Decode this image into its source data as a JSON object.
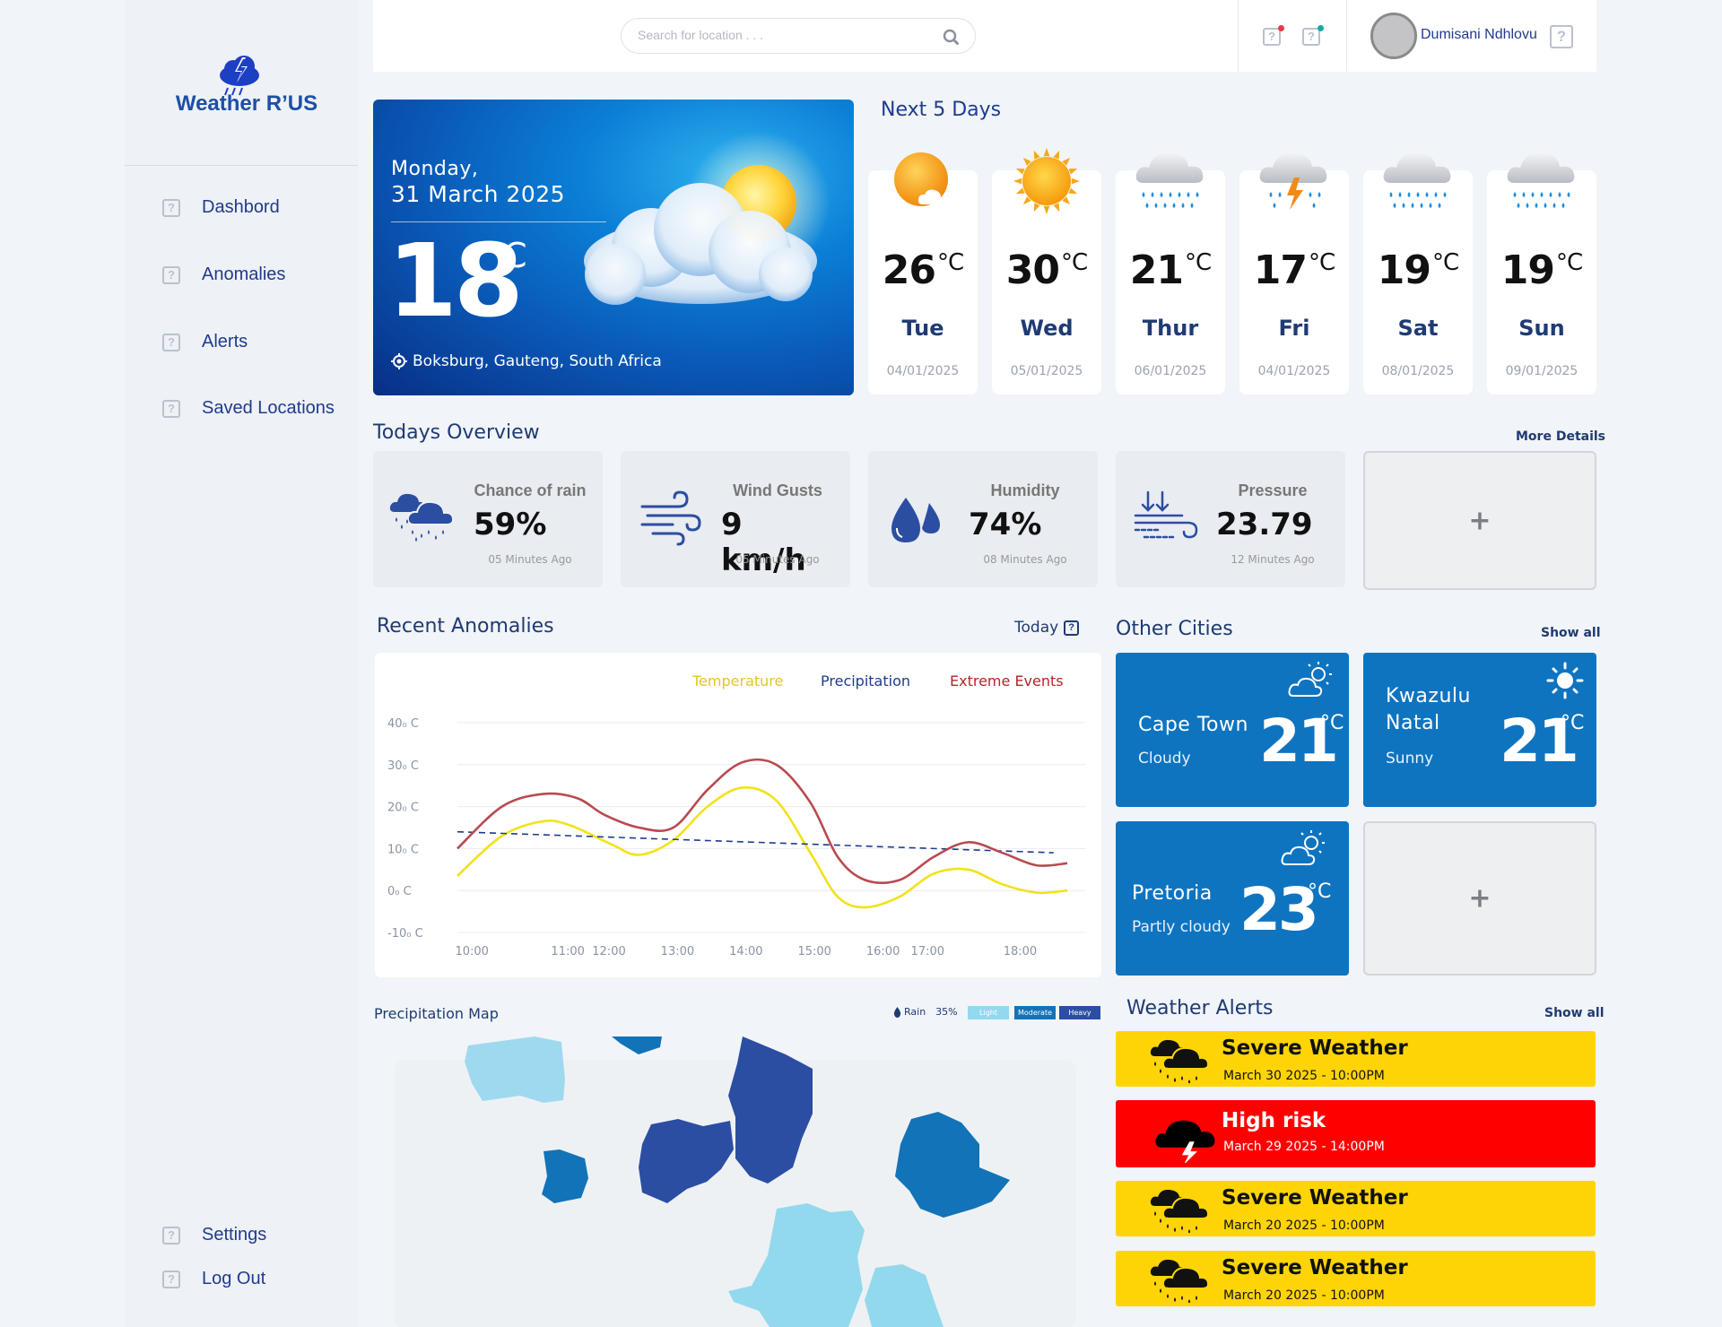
{
  "brand": {
    "name": "Weather R’US"
  },
  "nav": {
    "items": [
      "Dashbord",
      "Anomalies",
      "Alerts",
      "Saved Locations"
    ],
    "bottom": [
      "Settings",
      "Log Out"
    ]
  },
  "search": {
    "placeholder": "Search for location . . ."
  },
  "user": {
    "name": "Dumisani Ndhlovu",
    "q": "?"
  },
  "hero": {
    "weekday": "Monday,",
    "date": "31 March 2025",
    "temp": "18",
    "unit": "°C",
    "location": "Boksburg, Gauteng, South Africa"
  },
  "forecast": {
    "title": "Next 5 Days",
    "days": [
      {
        "temp": "26",
        "unit": "°C",
        "name": "Tue",
        "date": "04/01/2025",
        "icon": "sun-cloud"
      },
      {
        "temp": "30",
        "unit": "°C",
        "name": "Wed",
        "date": "05/01/2025",
        "icon": "sun"
      },
      {
        "temp": "21",
        "unit": "°C",
        "name": "Thur",
        "date": "06/01/2025",
        "icon": "rain-cloud"
      },
      {
        "temp": "17",
        "unit": "°C",
        "name": "Fri",
        "date": "04/01/2025",
        "icon": "storm-cloud"
      },
      {
        "temp": "19",
        "unit": "°C",
        "name": "Sat",
        "date": "08/01/2025",
        "icon": "rain-cloud"
      },
      {
        "temp": "19",
        "unit": "°C",
        "name": "Sun",
        "date": "09/01/2025",
        "icon": "rain-cloud"
      }
    ]
  },
  "overview": {
    "title": "Todays Overview",
    "more": "More Details",
    "add": "+",
    "cards": [
      {
        "label": "Chance of rain",
        "value": "59%",
        "time": "05 Minutes Ago",
        "icon": "rain-icon"
      },
      {
        "label": "Wind Gusts",
        "value": "9 km/h",
        "time": "05 Minutes Ago",
        "icon": "wind-icon"
      },
      {
        "label": "Humidity",
        "value": "74%",
        "time": "08 Minutes Ago",
        "icon": "humidity-icon"
      },
      {
        "label": "Pressure",
        "value": "23.79",
        "time": "12 Minutes Ago",
        "icon": "pressure-icon"
      }
    ]
  },
  "anomalies": {
    "title": "Recent Anomalies",
    "filter": "Today",
    "filter_q": "?"
  },
  "chart_data": {
    "type": "line",
    "title": "",
    "legend": [
      "Temperature",
      "Precipitation",
      "Extreme Events"
    ],
    "colors": {
      "Temperature": "#f2e21a",
      "Precipitation": "#1f3b8f",
      "Extreme Events": "#b94a4f"
    },
    "yticks": [
      "40₀ C",
      "30₀ C",
      "20₀ C",
      "10₀ C",
      "0₀ C",
      "-10₀ C"
    ],
    "ylim": [
      -10,
      40
    ],
    "xticks": [
      "10:00",
      "11:00",
      "12:00",
      "13:00",
      "14:00",
      "15:00",
      "16:00",
      "17:00",
      "18:00"
    ],
    "xtick_hours": [
      10.0,
      11.4,
      12.0,
      13.0,
      14.0,
      15.0,
      16.0,
      16.65,
      18.0
    ],
    "xlim": [
      9.85,
      18.75
    ],
    "series": [
      {
        "name": "Temperature",
        "x": [
          9.85,
          10.5,
          11.1,
          11.5,
          12.1,
          12.5,
          13.0,
          13.5,
          14.0,
          14.5,
          15.0,
          15.4,
          15.8,
          16.3,
          16.8,
          17.3,
          17.8,
          18.3,
          18.75
        ],
        "y": [
          3.5,
          13,
          16.5,
          15.5,
          11,
          8.5,
          12,
          20,
          24.5,
          21.5,
          9,
          -1.5,
          -4,
          -1.5,
          4,
          5,
          1.5,
          -0.5,
          0
        ]
      },
      {
        "name": "Precipitation",
        "x": [
          9.85,
          18.55
        ],
        "y": [
          14,
          9
        ]
      },
      {
        "name": "Extreme Events",
        "x": [
          9.85,
          10.5,
          11.1,
          11.6,
          12.0,
          12.5,
          13.0,
          13.5,
          14.0,
          14.5,
          15.0,
          15.4,
          15.8,
          16.3,
          16.8,
          17.3,
          17.8,
          18.3,
          18.75
        ],
        "y": [
          10,
          20,
          23,
          22,
          18,
          15,
          15,
          24,
          30.5,
          30,
          21,
          8,
          2.5,
          2.5,
          8,
          11.5,
          9,
          6,
          6.5
        ]
      }
    ]
  },
  "cities": {
    "title": "Other Cities",
    "show_all": "Show all",
    "add": "+",
    "items": [
      {
        "name": "Cape Town",
        "cond": "Cloudy",
        "temp": "21",
        "unit": "°C"
      },
      {
        "name": "Kwazulu Natal",
        "cond": "Sunny",
        "temp": "21",
        "unit": "°C"
      },
      {
        "name": "Pretoria",
        "cond": "Partly cloudy",
        "temp": "23",
        "unit": "°C"
      }
    ]
  },
  "map": {
    "title": "Precipitation Map",
    "rain_label": "Rain",
    "rain_value": "35%",
    "legend": [
      "Light",
      "Moderate",
      "Heavy"
    ],
    "legend_colors": [
      "#93d9ee",
      "#1273b9",
      "#2b4ea3"
    ]
  },
  "alerts": {
    "title": "Weather Alerts",
    "show_all": "Show all",
    "items": [
      {
        "title": "Severe Weather",
        "time": "March 30 2025 - 10:00PM",
        "color": "#ffd407",
        "text_color": "#111"
      },
      {
        "title": "High risk",
        "time": "March 29 2025 - 14:00PM",
        "color": "#ff0000",
        "text_color": "#fff"
      },
      {
        "title": "Severe Weather",
        "time": "March 20 2025 - 10:00PM",
        "color": "#ffd407",
        "text_color": "#111"
      },
      {
        "title": "Severe Weather",
        "time": "March 20 2025 - 10:00PM",
        "color": "#ffd407",
        "text_color": "#111"
      }
    ]
  }
}
